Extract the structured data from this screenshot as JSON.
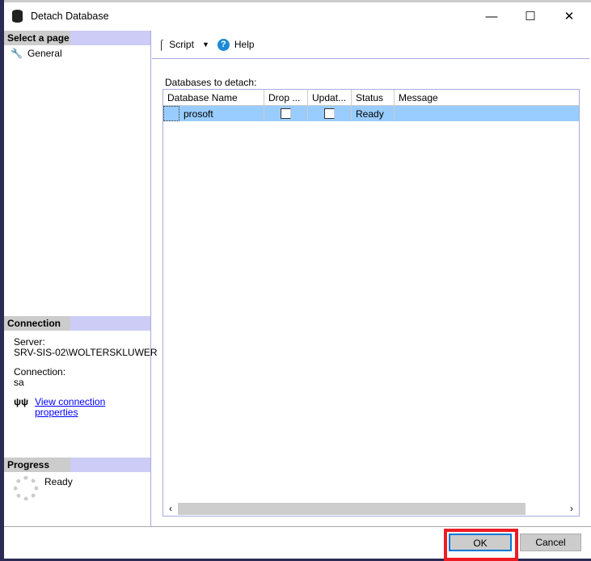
{
  "window": {
    "title": "Detach Database"
  },
  "left": {
    "select_page": "Select a page",
    "pages": [
      {
        "label": "General"
      }
    ],
    "connection_header": "Connection",
    "server_label": "Server:",
    "server_value": "SRV-SIS-02\\WOLTERSKLUWER",
    "connection_label": "Connection:",
    "connection_value": "sa",
    "view_props": "View connection properties",
    "progress_header": "Progress",
    "progress_status": "Ready"
  },
  "toolbar": {
    "script": "Script",
    "help": "Help"
  },
  "grid": {
    "label": "Databases to detach:",
    "columns": [
      "Database Name",
      "Drop ...",
      "Updat...",
      "Status",
      "Message"
    ],
    "rows": [
      {
        "name": "prosoft",
        "drop": false,
        "update": false,
        "status": "Ready",
        "message": ""
      }
    ]
  },
  "footer": {
    "ok": "OK",
    "cancel": "Cancel"
  },
  "colors": {
    "highlight": "#ed1c24",
    "selection": "#99ccff",
    "section": "#ccccf6"
  }
}
